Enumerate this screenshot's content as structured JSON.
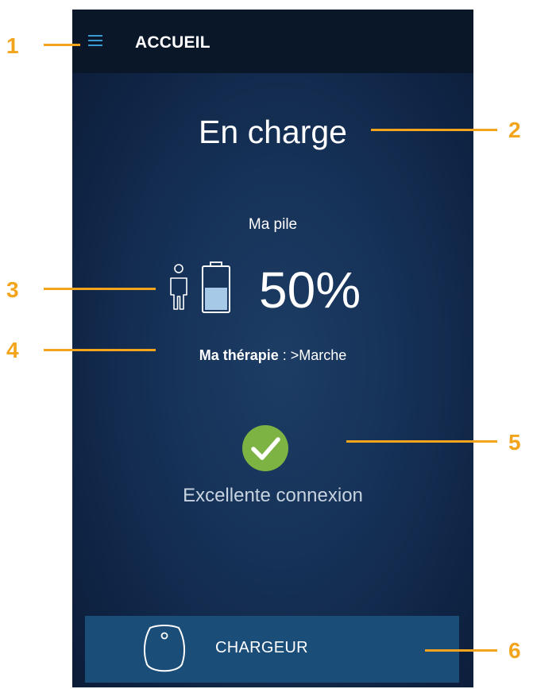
{
  "header": {
    "title": "ACCUEIL",
    "menu_icon": "hamburger-menu-icon"
  },
  "status": {
    "title": "En charge"
  },
  "battery": {
    "heading": "Ma pile",
    "percent": "50%",
    "level": 0.5,
    "person_icon": "person-icon",
    "battery_icon": "battery-icon"
  },
  "therapy": {
    "label": "Ma thérapie",
    "separator": " : ",
    "value": ">Marche"
  },
  "connection": {
    "icon": "check-circle-icon",
    "text": "Excellente connexion",
    "color": "#7cb342"
  },
  "charger": {
    "label": "CHARGEUR",
    "icon": "charger-icon"
  },
  "callouts": [
    "1",
    "2",
    "3",
    "4",
    "5",
    "6"
  ],
  "colors": {
    "accent": "#f2a51c",
    "menu_icon": "#3b9ad6",
    "top_bar": "#0a1728",
    "button": "#1b4d79"
  }
}
